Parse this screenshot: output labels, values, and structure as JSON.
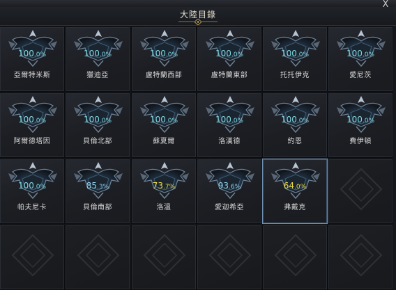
{
  "window": {
    "title": "大陸目錄",
    "close_label": "X"
  },
  "colors": {
    "full": "#7fd6e0",
    "partial_blue": "#8fd0ea",
    "partial_yellow": "#e8d84a"
  },
  "regions": [
    {
      "name": "亞爾特米斯",
      "pct_int": "100",
      "pct_dec": ".0%",
      "tone": "full"
    },
    {
      "name": "獵迪亞",
      "pct_int": "100",
      "pct_dec": ".0%",
      "tone": "full"
    },
    {
      "name": "盧特蘭西部",
      "pct_int": "100",
      "pct_dec": ".0%",
      "tone": "full"
    },
    {
      "name": "盧特蘭東部",
      "pct_int": "100",
      "pct_dec": ".0%",
      "tone": "full"
    },
    {
      "name": "托托伊克",
      "pct_int": "100",
      "pct_dec": ".0%",
      "tone": "full"
    },
    {
      "name": "愛尼茨",
      "pct_int": "100",
      "pct_dec": ".0%",
      "tone": "full"
    },
    {
      "name": "阿爾德塔因",
      "pct_int": "100",
      "pct_dec": ".0%",
      "tone": "full"
    },
    {
      "name": "貝倫北部",
      "pct_int": "100",
      "pct_dec": ".0%",
      "tone": "full"
    },
    {
      "name": "蘇夏爾",
      "pct_int": "100",
      "pct_dec": ".0%",
      "tone": "full"
    },
    {
      "name": "洛漢德",
      "pct_int": "100",
      "pct_dec": ".0%",
      "tone": "full"
    },
    {
      "name": "約恩",
      "pct_int": "100",
      "pct_dec": ".0%",
      "tone": "full"
    },
    {
      "name": "費伊頓",
      "pct_int": "100",
      "pct_dec": ".0%",
      "tone": "full"
    },
    {
      "name": "帕夫尼卡",
      "pct_int": "100",
      "pct_dec": ".0%",
      "tone": "full"
    },
    {
      "name": "貝倫南部",
      "pct_int": "85",
      "pct_dec": ".3%",
      "tone": "partial_blue"
    },
    {
      "name": "洛溫",
      "pct_int": "73",
      "pct_dec": ".7%",
      "tone": "partial_yellow"
    },
    {
      "name": "愛迦希亞",
      "pct_int": "93",
      "pct_dec": ".6%",
      "tone": "partial_blue"
    },
    {
      "name": "弗戴克",
      "pct_int": "64",
      "pct_dec": ".0%",
      "tone": "partial_yellow",
      "selected": true
    }
  ]
}
